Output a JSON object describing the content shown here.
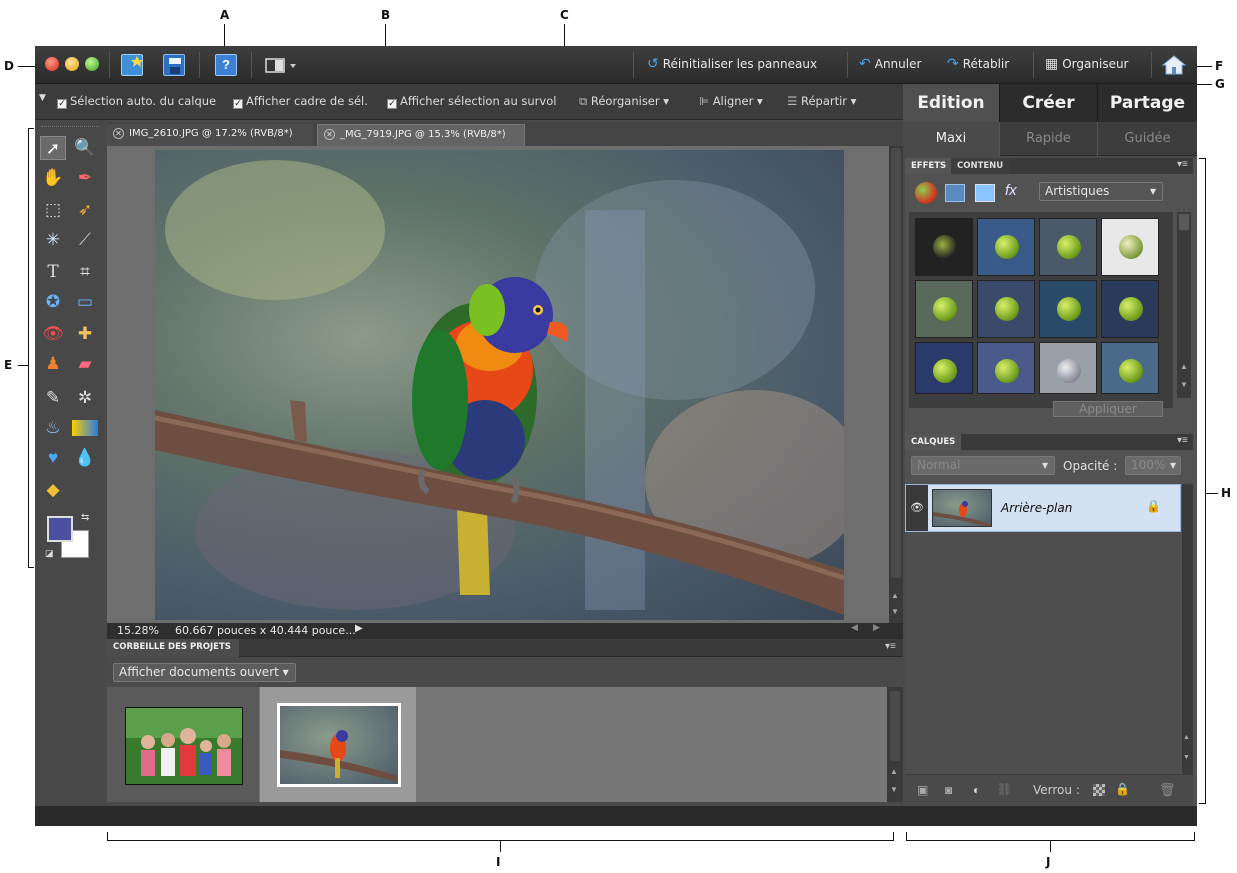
{
  "callouts": {
    "A": "A",
    "B": "B",
    "C": "C",
    "D": "D",
    "E": "E",
    "F": "F",
    "G": "G",
    "H": "H",
    "I": "I",
    "J": "J"
  },
  "menubar": {
    "reset_panels": "Réinitialiser les panneaux",
    "undo": "Annuler",
    "redo": "Rétablir",
    "organizer": "Organiseur"
  },
  "options": {
    "auto_select": "Sélection auto. du calque",
    "show_bbox": "Afficher cadre de sél.",
    "show_hover": "Afficher sélection au survol",
    "arrange": "Réorganiser",
    "align": "Aligner",
    "distribute": "Répartir"
  },
  "mode_tabs": [
    "Edition",
    "Créer",
    "Partage"
  ],
  "sub_tabs": [
    "Maxi",
    "Rapide",
    "Guidée"
  ],
  "document_tabs": [
    {
      "label": "IMG_2610.JPG @ 17.2% (RVB/8*)"
    },
    {
      "label": "_MG_7919.JPG @ 15.3% (RVB/8*)"
    }
  ],
  "status": {
    "zoom": "15.28%",
    "size": "60.667 pouces x 40.444 pouce..."
  },
  "project_bin": {
    "title": "CORBEILLE DES PROJETS",
    "dropdown": "Afficher documents ouvert"
  },
  "effects": {
    "tabs": [
      "EFFETS",
      "CONTENU"
    ],
    "category": "Artistiques",
    "apply": "Appliquer"
  },
  "layers": {
    "title": "CALQUES",
    "blend_mode": "Normal",
    "opacity_label": "Opacité :",
    "opacity_value": "100%",
    "layer_name": "Arrière-plan",
    "lock_label": "Verrou :"
  },
  "colors": {
    "foreground": "#4b4fa0",
    "background": "#ffffff",
    "selected_layer": "#c8daf0",
    "accent_blue": "#4aa3e8"
  }
}
